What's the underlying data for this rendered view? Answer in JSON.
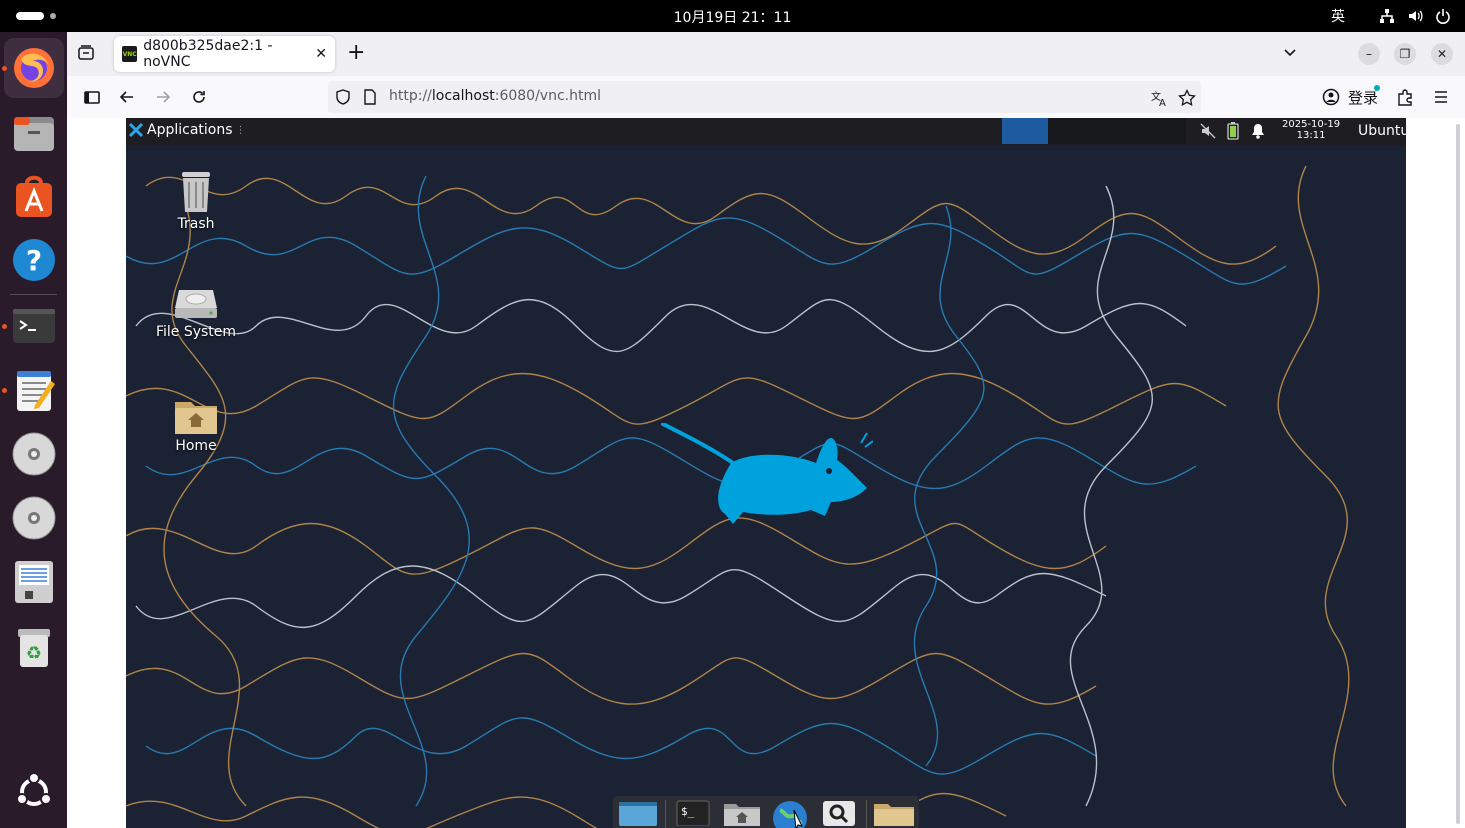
{
  "topbar": {
    "clock": "10月19日  21：11",
    "input_method": "英"
  },
  "dock": {
    "apps": [
      "Firefox",
      "Files",
      "App Center",
      "Help",
      "Terminal",
      "Text Editor",
      "Optical Disc",
      "Optical Disc",
      "Document Scanner",
      "Trash",
      "Show Apps"
    ]
  },
  "browser": {
    "tab_title": "d800b325dae2:1 - noVNC",
    "favicon_text": "VNC",
    "url_prefix": "http://",
    "url_host": "localhost",
    "url_rest": ":6080/vnc.html",
    "login_label": "登录"
  },
  "remote": {
    "applications_label": "Applications",
    "date": "2025-10-19",
    "time": "13:11",
    "user": "Ubuntu",
    "desktop_icons": [
      {
        "label": "Trash"
      },
      {
        "label": "File System"
      },
      {
        "label": "Home"
      }
    ]
  },
  "colors": {
    "ubuntu_orange": "#e95420",
    "xfce_blue": "#00a2de",
    "wallpaper": "#1b2233"
  }
}
